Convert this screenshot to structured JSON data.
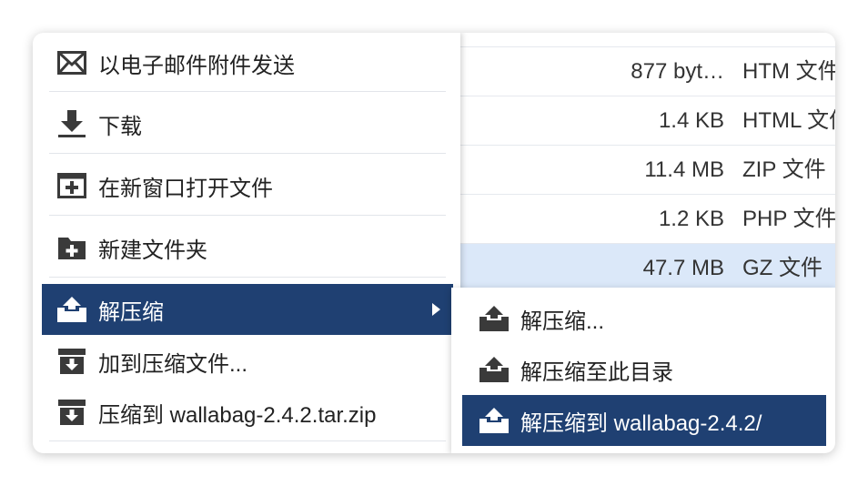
{
  "files": [
    {
      "size": "",
      "type": ""
    },
    {
      "size": "877 byt…",
      "type": "HTM 文件"
    },
    {
      "size": "1.4 KB",
      "type": "HTML 文件"
    },
    {
      "size": "11.4 MB",
      "type": "ZIP 文件"
    },
    {
      "size": "1.2 KB",
      "type": "PHP 文件"
    },
    {
      "size": "47.7 MB",
      "type": "GZ 文件"
    }
  ],
  "menu": {
    "email_label": "以电子邮件附件发送",
    "download_label": "下载",
    "open_new_window_label": "在新窗口打开文件",
    "new_folder_label": "新建文件夹",
    "extract_label": "解压缩",
    "add_archive_label": "加到压缩文件...",
    "compress_to_label": "压缩到 wallabag-2.4.2.tar.zip"
  },
  "submenu": {
    "extract_dialog_label": "解压缩...",
    "extract_here_label": "解压缩至此目录",
    "extract_to_label": "解压缩到 wallabag-2.4.2/"
  },
  "colors": {
    "highlight": "#1f4072",
    "selected_row": "#dbe8f9",
    "icon_dark": "#3a3a3a"
  }
}
